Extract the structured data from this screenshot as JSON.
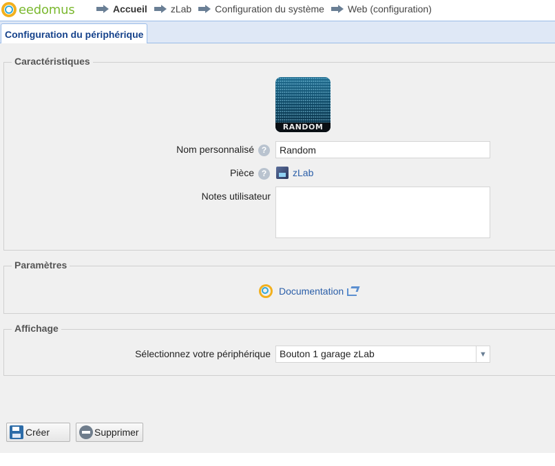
{
  "header": {
    "logo_text": "eedomus",
    "breadcrumbs": [
      {
        "label": "Accueil",
        "active": true
      },
      {
        "label": "zLab",
        "active": false
      },
      {
        "label": "Configuration du système",
        "active": false
      },
      {
        "label": "Web (configuration)",
        "active": false
      }
    ]
  },
  "tab": {
    "label": "Configuration du périphérique"
  },
  "characteristics": {
    "legend": "Caractéristiques",
    "image_caption": "RANDOM",
    "name_label": "Nom personnalisé",
    "name_value": "Random",
    "room_label": "Pièce",
    "room_value": "zLab",
    "notes_label": "Notes utilisateur",
    "notes_value": "",
    "help_glyph": "?"
  },
  "parameters": {
    "legend": "Paramètres",
    "documentation_label": "Documentation"
  },
  "display": {
    "legend": "Affichage",
    "device_label": "Sélectionnez votre périphérique",
    "device_value": "Bouton 1 garage zLab"
  },
  "actions": {
    "create_label": "Créer",
    "delete_label": "Supprimer"
  },
  "colors": {
    "tab_text": "#15428b",
    "link": "#2a5ea8",
    "logo_green": "#7ab82e",
    "logo_yellow": "#f2b01e",
    "logo_blue": "#2fa8d8"
  },
  "icons": [
    "eedomus-logo-icon",
    "breadcrumb-arrow-icon",
    "help-icon",
    "room-icon",
    "documentation-icon",
    "external-link-icon",
    "dropdown-chevron-icon",
    "floppy-save-icon",
    "minus-circle-icon"
  ]
}
